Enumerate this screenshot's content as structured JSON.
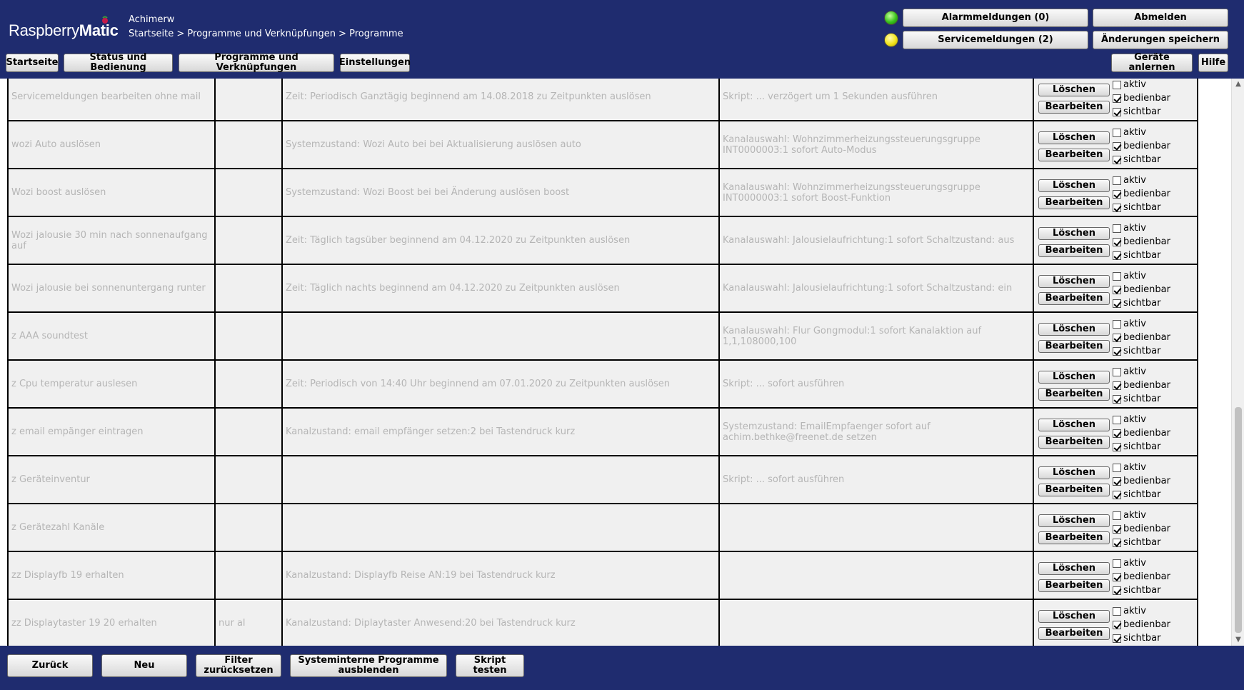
{
  "header": {
    "logo_raspberry": "Raspberry",
    "logo_matic": "Matic",
    "user": "Achimerw",
    "breadcrumb": "Startseite > Programme und Verknüpfungen > Programme",
    "alarm_button": "Alarmmeldungen (0)",
    "service_button": "Servicemeldungen (2)",
    "logout_button": "Abmelden",
    "save_button": "Änderungen speichern",
    "alarm_led_color": "#38c21a",
    "service_led_color": "#f2e31a"
  },
  "nav": {
    "home": "Startseite",
    "status": "Status und Bedienung",
    "programs": "Programme und Verknüpfungen",
    "settings": "Einstellungen",
    "teach": "Geräte anlernen",
    "help": "Hilfe"
  },
  "row_labels": {
    "delete": "Löschen",
    "edit": "Bearbeiten",
    "active": "aktiv",
    "operable": "bedienbar",
    "visible": "sichtbar"
  },
  "programs": [
    {
      "name": "Servicemeldungen bearbeiten ohne mail",
      "desc": "",
      "condition": "Zeit: Periodisch Ganztägig beginnend am 14.08.2018 zu Zeitpunkten auslösen",
      "action": "Skript: ... verzögert um 1 Sekunden ausführen",
      "aktiv": false,
      "bedienbar": true,
      "sichtbar": true
    },
    {
      "name": "wozi Auto auslösen",
      "desc": "",
      "condition": "Systemzustand: Wozi Auto bei bei Aktualisierung auslösen auto",
      "action": "Kanalauswahl: Wohnzimmerheizungssteuerungsgruppe INT0000003:1 sofort Auto-Modus",
      "aktiv": false,
      "bedienbar": true,
      "sichtbar": true
    },
    {
      "name": "Wozi boost auslösen",
      "desc": "",
      "condition": "Systemzustand: Wozi Boost bei bei Änderung auslösen boost",
      "action": "Kanalauswahl: Wohnzimmerheizungssteuerungsgruppe INT0000003:1 sofort Boost-Funktion",
      "aktiv": false,
      "bedienbar": true,
      "sichtbar": true
    },
    {
      "name": "Wozi jalousie 30 min nach sonnenaufgang auf",
      "desc": "",
      "condition": "Zeit: Täglich tagsüber beginnend am 04.12.2020 zu Zeitpunkten auslösen",
      "action": "Kanalauswahl: Jalousielaufrichtung:1 sofort Schaltzustand: aus",
      "aktiv": false,
      "bedienbar": true,
      "sichtbar": true
    },
    {
      "name": "Wozi jalousie bei sonnenuntergang runter",
      "desc": "",
      "condition": "Zeit: Täglich nachts beginnend am 04.12.2020 zu Zeitpunkten auslösen",
      "action": "Kanalauswahl: Jalousielaufrichtung:1 sofort Schaltzustand: ein",
      "aktiv": false,
      "bedienbar": true,
      "sichtbar": true
    },
    {
      "name": "z AAA soundtest",
      "desc": "",
      "condition": "",
      "action": "Kanalauswahl: Flur Gongmodul:1 sofort Kanalaktion auf 1,1,108000,100",
      "aktiv": false,
      "bedienbar": true,
      "sichtbar": true
    },
    {
      "name": "z Cpu temperatur auslesen",
      "desc": "",
      "condition": "Zeit: Periodisch von 14:40 Uhr beginnend am 07.01.2020 zu Zeitpunkten auslösen",
      "action": "Skript: ... sofort ausführen",
      "aktiv": false,
      "bedienbar": true,
      "sichtbar": true
    },
    {
      "name": "z email empänger eintragen",
      "desc": "",
      "condition": "Kanalzustand: email empfänger setzen:2 bei Tastendruck kurz",
      "action": "Systemzustand: EmailEmpfaenger sofort auf achim.bethke@freenet.de setzen",
      "aktiv": false,
      "bedienbar": true,
      "sichtbar": true
    },
    {
      "name": "z Geräteinventur",
      "desc": "",
      "condition": "",
      "action": "Skript: ... sofort ausführen",
      "aktiv": false,
      "bedienbar": true,
      "sichtbar": true
    },
    {
      "name": "z Gerätezahl Kanäle",
      "desc": "",
      "condition": "",
      "action": "",
      "aktiv": false,
      "bedienbar": true,
      "sichtbar": true
    },
    {
      "name": "zz Displayfb 19 erhalten",
      "desc": "",
      "condition": "Kanalzustand: Displayfb Reise AN:19 bei Tastendruck kurz",
      "action": "",
      "aktiv": false,
      "bedienbar": true,
      "sichtbar": true
    },
    {
      "name": "zz Displaytaster 19 20 erhalten",
      "desc": "nur al",
      "condition": "Kanalzustand: Diplaytaster Anwesend:20 bei Tastendruck kurz",
      "action": "",
      "aktiv": false,
      "bedienbar": true,
      "sichtbar": true
    }
  ],
  "footer": {
    "back": "Zurück",
    "new": "Neu",
    "filter_reset": "Filter zurücksetzen",
    "hide_internal": "Systeminterne Programme ausblenden",
    "test_script": "Skript testen"
  }
}
